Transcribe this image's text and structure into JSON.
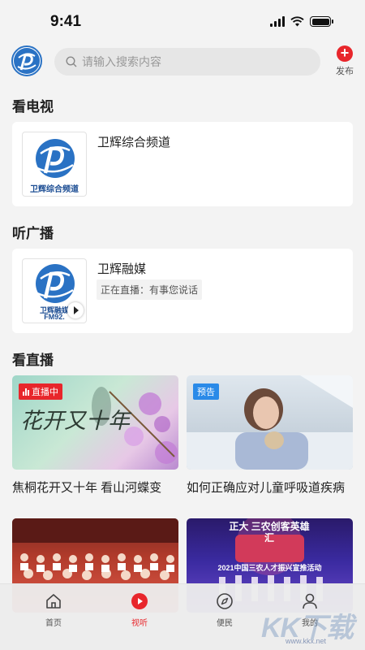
{
  "status_bar": {
    "time": "9:41"
  },
  "header": {
    "search_placeholder": "请输入搜索内容",
    "publish_label": "发布"
  },
  "tv": {
    "title": "看电视",
    "channel": {
      "name": "卫辉综合频道",
      "logo_text": "卫辉综合频道"
    }
  },
  "radio": {
    "title": "听广播",
    "station": {
      "name": "卫辉融媒",
      "status": "正在直播：有事您说话",
      "logo_text": "卫辉融媒",
      "logo_sub": "FM92."
    }
  },
  "live": {
    "title": "看直播",
    "items": [
      {
        "title": "焦桐花开又十年 看山河蝶变",
        "badge": "直播中",
        "image_text": "花开又十年"
      },
      {
        "title": "如何正确应对儿童呼吸道疾病",
        "badge": "预告"
      },
      {
        "title": ""
      },
      {
        "title": "",
        "image_text": "正大 三农创客英雄汇",
        "image_sub": "2021中国三农人才振兴宣推活动"
      }
    ]
  },
  "tabbar": {
    "items": [
      {
        "label": "首页",
        "icon": "home-icon"
      },
      {
        "label": "视听",
        "icon": "play-circle-icon",
        "active": true
      },
      {
        "label": "便民",
        "icon": "compass-icon"
      },
      {
        "label": "我的",
        "icon": "user-icon"
      }
    ]
  },
  "watermark": {
    "text": "KK下载",
    "url": "www.kkx.net"
  },
  "colors": {
    "accent": "#e8262b",
    "preview": "#2a8ae8",
    "brand_blue": "#2a72c4"
  }
}
